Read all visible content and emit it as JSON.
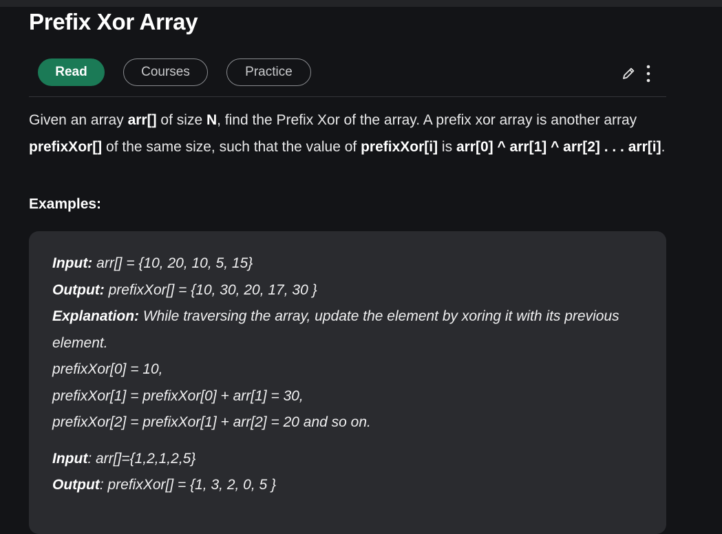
{
  "article": {
    "title": "Prefix Xor Array"
  },
  "tabs": {
    "read": "Read",
    "courses": "Courses",
    "practice": "Practice"
  },
  "actions": {
    "edit_icon": "pencil-icon",
    "more_icon": "vertical-dots-icon"
  },
  "intro": {
    "p1": "Given an array ",
    "b1": "arr[]",
    "p2": " of size ",
    "b2": "N",
    "p3": ", find the Prefix Xor of the array. A prefix xor array is another array ",
    "b3": "prefixXor[]",
    "p4": " of the same size, such that the value of ",
    "b4": "prefixXor[i]",
    "p5": " is ",
    "b5": "arr[0] ^ arr[1] ^ arr[2] . . . arr[i]",
    "p6": "."
  },
  "examples": {
    "heading": "Examples:",
    "ex1": {
      "input_label": "Input:",
      "input_value": " arr[] = {10, 20, 10, 5, 15}",
      "output_label": "Output:",
      "output_value": " prefixXor[] = {10, 30, 20, 17, 30 }",
      "explanation_label": "Explanation:",
      "explanation_text": " While traversing the array, update the element by xoring it with its previous element.",
      "line1": "prefixXor[0] = 10,",
      "line2": "prefixXor[1] = prefixXor[0] + arr[1] = 30,",
      "line3": "prefixXor[2] = prefixXor[1] + arr[2] = 20 and so on."
    },
    "ex2": {
      "input_label": "Input",
      "input_value": ": arr[]={1,2,1,2,5}",
      "output_label": "Output",
      "output_value": ": prefixXor[] = {1, 3, 2, 0, 5 }"
    }
  },
  "colors": {
    "background": "#131417",
    "read_tab": "#1b7a56",
    "example_box": "#2a2b2f"
  }
}
